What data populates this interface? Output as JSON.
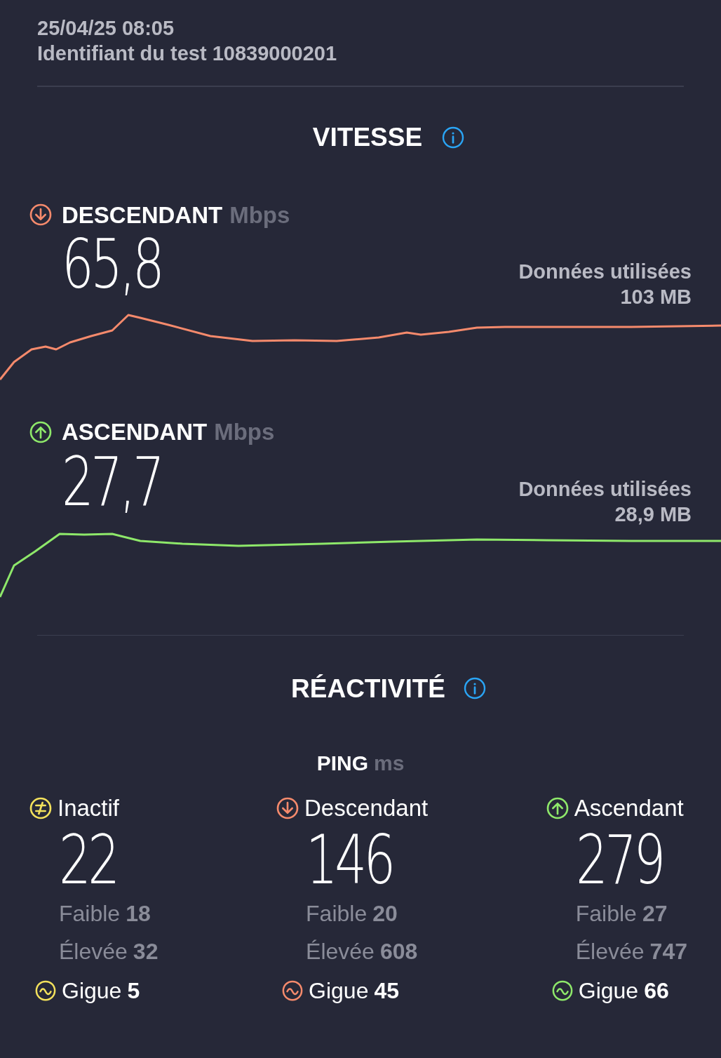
{
  "header": {
    "date": "25/04/25 08:05",
    "test_id": "Identifiant du test 10839000201"
  },
  "speed": {
    "title": "VITESSE",
    "metrics": [
      {
        "kind": "download",
        "label": "DESCENDANT",
        "unit": "Mbps",
        "value": "65,8",
        "data_label": "Données utilisées",
        "data_value": "103 MB"
      },
      {
        "kind": "upload",
        "label": "ASCENDANT",
        "unit": "Mbps",
        "value": "27,7",
        "data_label": "Données utilisées",
        "data_value": "28,9 MB"
      }
    ]
  },
  "responsiveness": {
    "title": "RÉACTIVITÉ",
    "ping_label": "PING",
    "ping_unit": "ms",
    "columns": [
      {
        "kind": "idle",
        "label": "Inactif",
        "value": "22",
        "low_label": "Faible",
        "low": "18",
        "high_label": "Élevée",
        "high": "32",
        "jitter_label": "Gigue",
        "jitter": "5"
      },
      {
        "kind": "download",
        "label": "Descendant",
        "value": "146",
        "low_label": "Faible",
        "low": "20",
        "high_label": "Élevée",
        "high": "608",
        "jitter_label": "Gigue",
        "jitter": "45"
      },
      {
        "kind": "upload",
        "label": "Ascendant",
        "value": "279",
        "low_label": "Faible",
        "low": "27",
        "high_label": "Élevée",
        "high": "747",
        "jitter_label": "Gigue",
        "jitter": "66"
      }
    ]
  }
}
